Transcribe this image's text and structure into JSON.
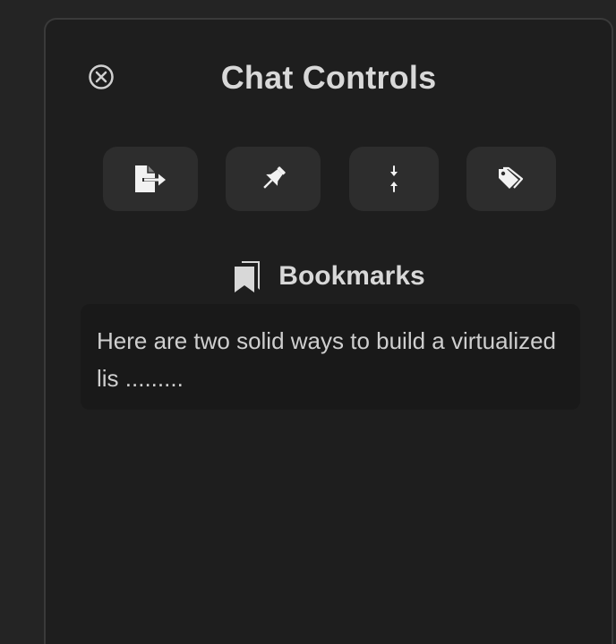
{
  "panel": {
    "title": "Chat Controls",
    "close_icon": "circle-x-icon"
  },
  "actions": [
    {
      "icon": "file-export-icon"
    },
    {
      "icon": "pin-icon"
    },
    {
      "icon": "collapse-arrows-icon"
    },
    {
      "icon": "tags-icon"
    }
  ],
  "bookmarks": {
    "icon": "bookmarks-icon",
    "title": "Bookmarks",
    "items": [
      {
        "text": "Here are two solid ways to build a virtualized lis ........."
      }
    ]
  },
  "colors": {
    "background": "#242424",
    "panel": "#1e1e1e",
    "button": "#2d2d2d",
    "item": "#191919",
    "text": "#d8d8d8"
  }
}
